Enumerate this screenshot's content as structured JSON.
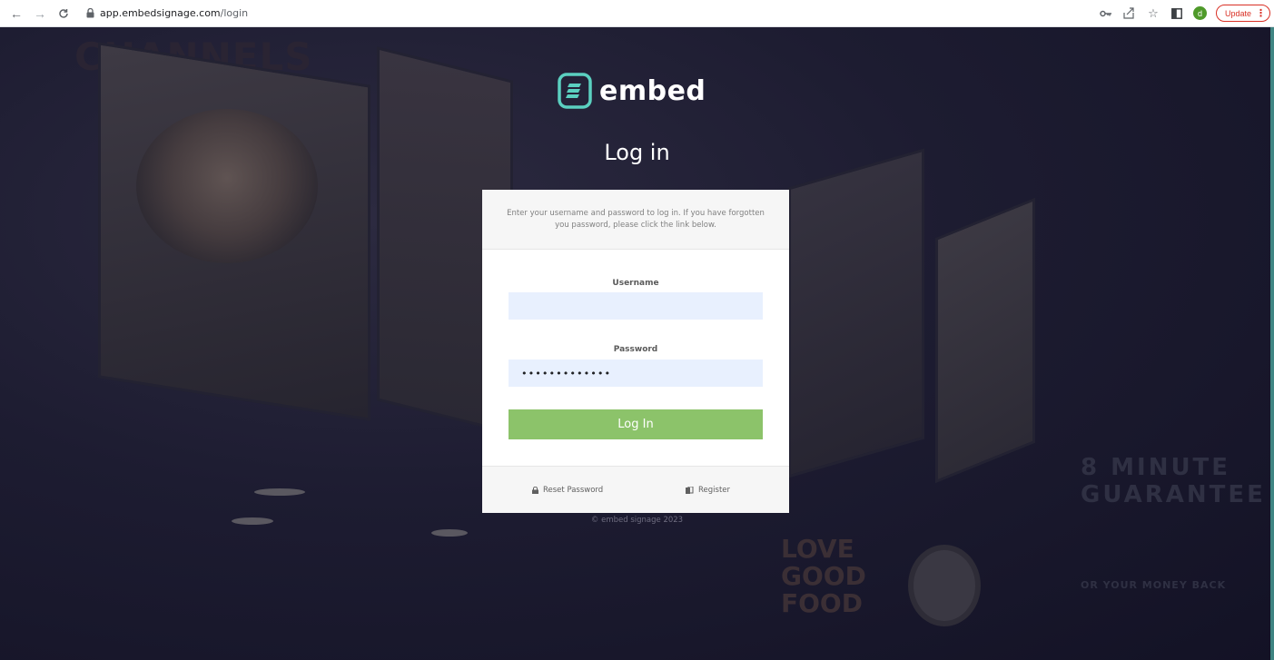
{
  "browser": {
    "url_host": "app.embedsignage.com",
    "url_path": "/login",
    "profile_initial": "d",
    "update_label": "Update",
    "icons": [
      "back-arrow-icon",
      "forward-arrow-icon",
      "reload-icon",
      "lock-icon",
      "key-icon",
      "share-icon",
      "star-icon",
      "sidebar-icon",
      "menu-dots-icon"
    ]
  },
  "background": {
    "heading": "CHANNELS",
    "guarantee_text": "8 MINUTE GUARANTEE",
    "money_back": "OR YOUR MONEY BACK",
    "love_text": "LOVE GOOD FOOD"
  },
  "brand": {
    "name": "embed",
    "accent": "#5bd0c0"
  },
  "page": {
    "title": "Log in"
  },
  "card": {
    "intro": "Enter your username and password to log in. If you have forgotten you password, please click the link below.",
    "username_label": "Username",
    "username_value": "",
    "password_label": "Password",
    "password_value": "•••••••••••••",
    "submit_label": "Log In",
    "submit_color": "#8cc36a",
    "reset_label": "Reset Password",
    "register_label": "Register"
  },
  "footer": {
    "copyright": "© embed signage 2023"
  }
}
